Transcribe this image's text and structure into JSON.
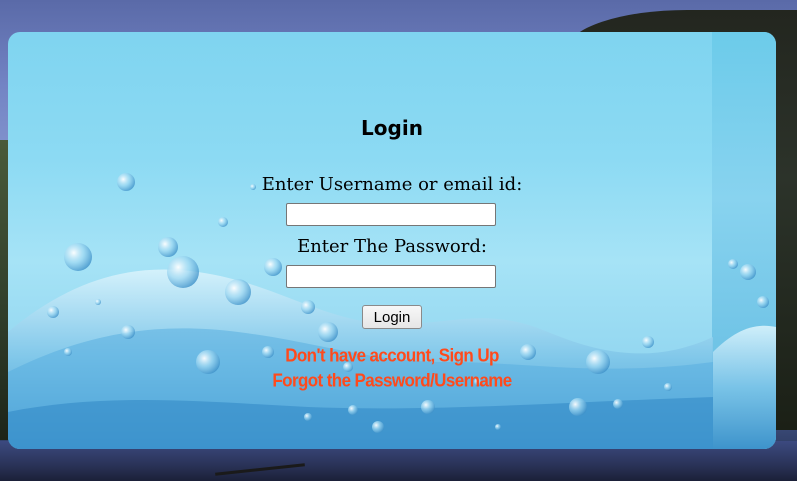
{
  "form": {
    "title": "Login",
    "username_label": "Enter Username or email id:",
    "username_value": "",
    "password_label": "Enter The Password:",
    "password_value": "",
    "login_button": "Login"
  },
  "links": {
    "signup": "Don't have account, Sign Up",
    "forgot": "Forgot the Password/Username"
  },
  "colors": {
    "link": "#ff4a1c",
    "card_bg": "#8cdaf3"
  }
}
